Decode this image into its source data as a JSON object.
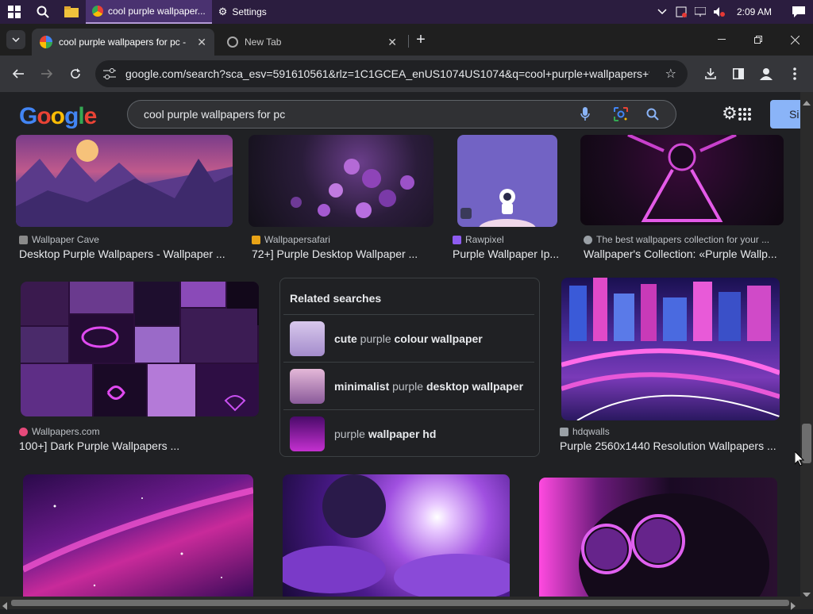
{
  "taskbar": {
    "apps": [
      {
        "label": "cool purple wallpaper...",
        "icon": "chrome-icon"
      },
      {
        "label": "Settings",
        "icon": "gear-icon"
      }
    ],
    "time": "2:09 AM"
  },
  "browser": {
    "tabs": [
      {
        "label": "cool purple wallpapers for pc - Go",
        "active": true
      },
      {
        "label": "New Tab",
        "active": false
      }
    ],
    "url": "google.com/search?sca_esv=591610561&rlz=1C1GCEA_enUS1074US1074&q=cool+purple+wallpapers+fo..."
  },
  "google": {
    "logo": "Google",
    "query": "cool purple wallpapers for pc",
    "signin_label": "Si"
  },
  "results_row1": [
    {
      "source": "Wallpaper Cave",
      "title": "Desktop Purple Wallpapers - Wallpaper ...",
      "fav": "#8a8a8a"
    },
    {
      "source": "Wallpapersafari",
      "title": "72+] Purple Desktop Wallpaper ...",
      "fav": "#e8a317"
    },
    {
      "source": "Rawpixel",
      "title": "Purple Wallpaper Ip...",
      "fav": "#8e5cf0"
    },
    {
      "source": "The best wallpapers collection for your ...",
      "title": "Wallpaper's Collection: «Purple Wallp...",
      "fav": "#9aa0a6"
    }
  ],
  "results_row2": [
    {
      "source": "Wallpapers.com",
      "title": "100+] Dark Purple Wallpapers ...",
      "fav": "#e64a7b"
    },
    {
      "source": "hdqwalls",
      "title": "Purple 2560x1440 Resolution Wallpapers ...",
      "fav": "#9aa0a6"
    }
  ],
  "related": {
    "heading": "Related searches",
    "items": [
      {
        "bold1": "cute",
        "normal": " purple ",
        "bold2": "colour wallpaper"
      },
      {
        "bold1": "minimalist",
        "normal": " purple ",
        "bold2": "desktop wallpaper"
      },
      {
        "bold1": "",
        "normal": "purple ",
        "bold2": "wallpaper hd"
      }
    ]
  }
}
